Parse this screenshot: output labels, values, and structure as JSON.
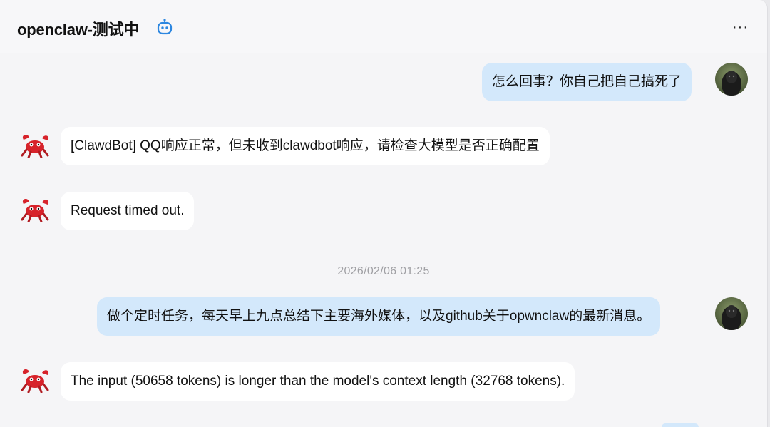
{
  "header": {
    "title": "openclaw-测试中",
    "bot_icon": "robot-icon",
    "more_icon": "more-horizontal-icon",
    "more_label": "···"
  },
  "colors": {
    "user_bubble": "#d3e8fb",
    "bot_bubble": "#ffffff",
    "background": "#f5f5f7",
    "bot_avatar": "#d7232b",
    "bot_icon_accent": "#2d87e0"
  },
  "messages": [
    {
      "sender": "user",
      "text": "怎么回事？你自己把自己搞死了"
    },
    {
      "sender": "bot",
      "text": "[ClawdBot] QQ响应正常，但未收到clawdbot响应，请检查大模型是否正确配置"
    },
    {
      "sender": "bot",
      "text": "Request timed out."
    },
    {
      "sender": "timestamp",
      "text": "2026/02/06 01:25"
    },
    {
      "sender": "user",
      "text": "做个定时任务，每天早上九点总结下主要海外媒体，以及github关于opwnclaw的最新消息。"
    },
    {
      "sender": "bot",
      "text": "The input (50658 tokens) is longer than the model's context length (32768 tokens)."
    }
  ]
}
